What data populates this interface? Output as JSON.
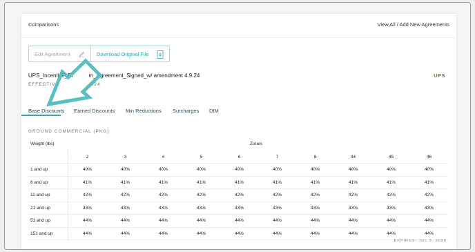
{
  "header": {
    "title": "Comparisons",
    "view_all": "View All / Add New Agreements"
  },
  "actions": {
    "edit_label": "Edit Agreement",
    "download_label": "Download Original File"
  },
  "agreement": {
    "name": "UPS_Incentive_Pr",
    "name_tail": "m_Agreement_Signed_w/ amendment 4.9.24",
    "carrier": "UPS",
    "effective_prefix": "EFFECTIVE",
    "effective_suffix": "024"
  },
  "tabs": [
    "Base Discounts",
    "Earned Discounts",
    "Min Reductions",
    "Surcharges",
    "DIM"
  ],
  "section": "GROUND COMMERCIAL (PKG)",
  "table": {
    "weight_header": "Weight (lbs)",
    "zones_header": "Zones",
    "zones": [
      "2",
      "3",
      "4",
      "5",
      "6",
      "7",
      "8",
      "44",
      "45",
      "46"
    ],
    "rows": [
      {
        "weight": "1 and up",
        "values": [
          "40%",
          "40%",
          "40%",
          "40%",
          "40%",
          "40%",
          "40%",
          "40%",
          "40%",
          "40%"
        ]
      },
      {
        "weight": "6 and up",
        "values": [
          "41%",
          "41%",
          "41%",
          "41%",
          "41%",
          "41%",
          "41%",
          "41%",
          "41%",
          "41%"
        ]
      },
      {
        "weight": "11 and up",
        "values": [
          "42%",
          "42%",
          "42%",
          "42%",
          "42%",
          "42%",
          "42%",
          "42%",
          "42%",
          "42%"
        ]
      },
      {
        "weight": "21 and up",
        "values": [
          "43%",
          "43%",
          "43%",
          "43%",
          "43%",
          "43%",
          "43%",
          "43%",
          "43%",
          "43%"
        ]
      },
      {
        "weight": "51 and up",
        "values": [
          "44%",
          "44%",
          "44%",
          "44%",
          "44%",
          "44%",
          "44%",
          "44%",
          "44%",
          "44%"
        ]
      },
      {
        "weight": "151 and up",
        "values": [
          "44%",
          "44%",
          "44%",
          "44%",
          "44%",
          "44%",
          "44%",
          "44%",
          "44%",
          "44%"
        ]
      }
    ]
  },
  "expires": "EXPIRES: JUL 3, 2026",
  "colors": {
    "accent": "#37a9ae",
    "arrow": "#5bbfc2",
    "carrier": "#8a6b3c"
  }
}
